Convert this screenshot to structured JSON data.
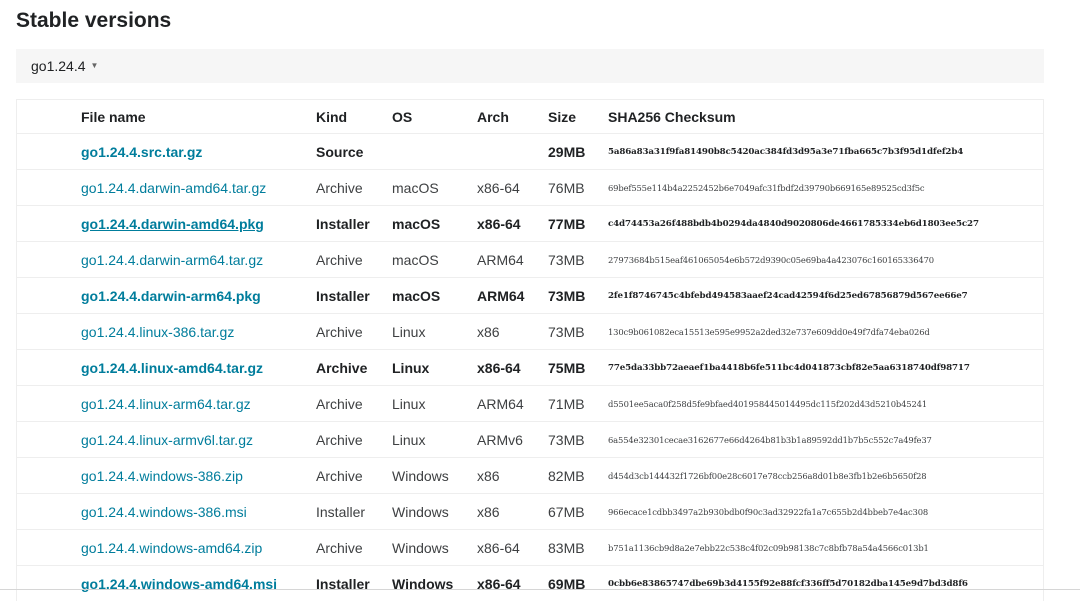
{
  "section": {
    "title": "Stable versions"
  },
  "version": {
    "label": "go1.24.4",
    "caret": "▼"
  },
  "table": {
    "headers": {
      "file_name": "File name",
      "kind": "Kind",
      "os": "OS",
      "arch": "Arch",
      "size": "Size",
      "checksum": "SHA256 Checksum"
    },
    "rows": [
      {
        "file": "go1.24.4.src.tar.gz",
        "kind": "Source",
        "os": "",
        "arch": "",
        "size": "29MB",
        "checksum": "5a86a83a31f9fa81490b8c5420ac384fd3d95a3e71fba665c7b3f95d1dfef2b4",
        "featured": true
      },
      {
        "file": "go1.24.4.darwin-amd64.tar.gz",
        "kind": "Archive",
        "os": "macOS",
        "arch": "x86-64",
        "size": "76MB",
        "checksum": "69bef555e114b4a2252452b6e7049afc31fbdf2d39790b669165e89525cd3f5c",
        "featured": false
      },
      {
        "file": "go1.24.4.darwin-amd64.pkg",
        "kind": "Installer",
        "os": "macOS",
        "arch": "x86-64",
        "size": "77MB",
        "checksum": "c4d74453a26f488bdb4b0294da4840d9020806de4661785334eb6d1803ee5c27",
        "featured": true
      },
      {
        "file": "go1.24.4.darwin-arm64.tar.gz",
        "kind": "Archive",
        "os": "macOS",
        "arch": "ARM64",
        "size": "73MB",
        "checksum": "27973684b515eaf461065054e6b572d9390c05e69ba4a423076c160165336470",
        "featured": false
      },
      {
        "file": "go1.24.4.darwin-arm64.pkg",
        "kind": "Installer",
        "os": "macOS",
        "arch": "ARM64",
        "size": "73MB",
        "checksum": "2fe1f8746745c4bfebd494583aaef24cad42594f6d25ed67856879d567ee66e7",
        "featured": true
      },
      {
        "file": "go1.24.4.linux-386.tar.gz",
        "kind": "Archive",
        "os": "Linux",
        "arch": "x86",
        "size": "73MB",
        "checksum": "130c9b061082eca15513e595e9952a2ded32e737e609dd0e49f7dfa74eba026d",
        "featured": false
      },
      {
        "file": "go1.24.4.linux-amd64.tar.gz",
        "kind": "Archive",
        "os": "Linux",
        "arch": "x86-64",
        "size": "75MB",
        "checksum": "77e5da33bb72aeaef1ba4418b6fe511bc4d041873cbf82e5aa6318740df98717",
        "featured": true
      },
      {
        "file": "go1.24.4.linux-arm64.tar.gz",
        "kind": "Archive",
        "os": "Linux",
        "arch": "ARM64",
        "size": "71MB",
        "checksum": "d5501ee5aca0f258d5fe9bfaed401958445014495dc115f202d43d5210b45241",
        "featured": false
      },
      {
        "file": "go1.24.4.linux-armv6l.tar.gz",
        "kind": "Archive",
        "os": "Linux",
        "arch": "ARMv6",
        "size": "73MB",
        "checksum": "6a554e32301cecae3162677e66d4264b81b3b1a89592dd1b7b5c552c7a49fe37",
        "featured": false
      },
      {
        "file": "go1.24.4.windows-386.zip",
        "kind": "Archive",
        "os": "Windows",
        "arch": "x86",
        "size": "82MB",
        "checksum": "d454d3cb144432f1726bf00e28c6017e78ccb256a8d01b8e3fb1b2e6b5650f28",
        "featured": false
      },
      {
        "file": "go1.24.4.windows-386.msi",
        "kind": "Installer",
        "os": "Windows",
        "arch": "x86",
        "size": "67MB",
        "checksum": "966ecace1cdbb3497a2b930bdb0f90c3ad32922fa1a7c655b2d4bbeb7e4ac308",
        "featured": false
      },
      {
        "file": "go1.24.4.windows-amd64.zip",
        "kind": "Archive",
        "os": "Windows",
        "arch": "x86-64",
        "size": "83MB",
        "checksum": "b751a1136cb9d8a2e7ebb22c538c4f02c09b98138c7c8bfb78a54a4566c013b1",
        "featured": false
      },
      {
        "file": "go1.24.4.windows-amd64.msi",
        "kind": "Installer",
        "os": "Windows",
        "arch": "x86-64",
        "size": "69MB",
        "checksum": "0cbb6e83865747dbe69b3d4155f92e88fcf336ff5d70182dba145e9d7bd3d8f6",
        "featured": true
      }
    ]
  }
}
